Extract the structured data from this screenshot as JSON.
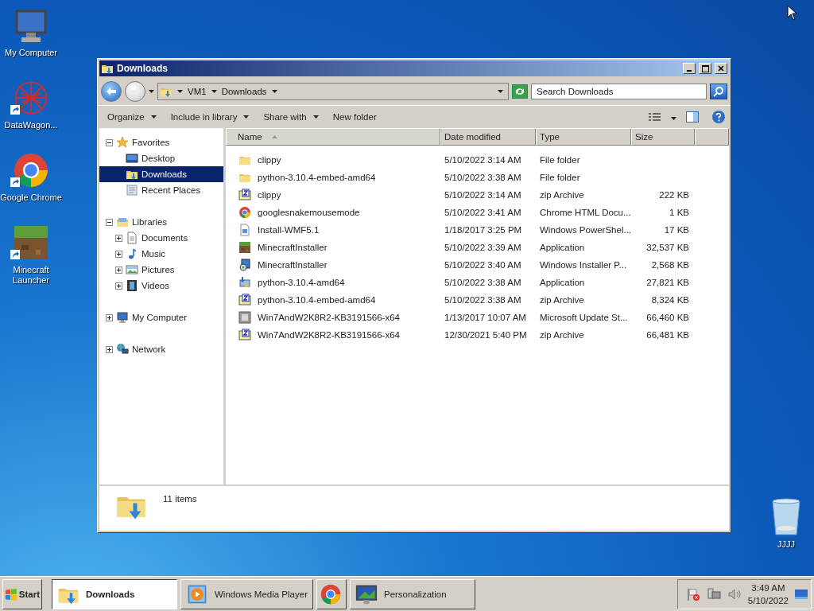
{
  "desktop_icons": [
    {
      "label": "My Computer",
      "kind": "computer",
      "shortcut": false
    },
    {
      "label": "DataWagon...",
      "kind": "datawagon",
      "shortcut": true
    },
    {
      "label": "Google Chrome",
      "kind": "chrome",
      "shortcut": true
    },
    {
      "label": "Minecraft Launcher",
      "kind": "minecraft",
      "shortcut": true
    }
  ],
  "recycle_bin": {
    "label": "JJJJ"
  },
  "window": {
    "title": "Downloads",
    "address": {
      "segments": [
        "VM1",
        "Downloads"
      ]
    },
    "search": {
      "placeholder": "Search Downloads"
    },
    "toolbar": [
      {
        "label": "Organize",
        "menu": true
      },
      {
        "label": "Include in library",
        "menu": true
      },
      {
        "label": "Share with",
        "menu": true
      },
      {
        "label": "New folder",
        "menu": false
      }
    ],
    "nav": [
      {
        "label": "Favorites",
        "kind": "star",
        "expanded": true,
        "children": [
          {
            "label": "Desktop",
            "kind": "desktop",
            "selected": false
          },
          {
            "label": "Downloads",
            "kind": "downloads",
            "selected": true
          },
          {
            "label": "Recent Places",
            "kind": "recent",
            "selected": false
          }
        ]
      },
      {
        "label": "Libraries",
        "kind": "library",
        "expanded": true,
        "children": [
          {
            "label": "Documents",
            "kind": "documents",
            "expanded": false,
            "selected": false
          },
          {
            "label": "Music",
            "kind": "music",
            "expanded": false,
            "selected": false
          },
          {
            "label": "Pictures",
            "kind": "pictures",
            "expanded": false,
            "selected": false
          },
          {
            "label": "Videos",
            "kind": "videos",
            "expanded": false,
            "selected": false
          }
        ]
      },
      {
        "label": "My Computer",
        "kind": "computer",
        "expanded": false
      },
      {
        "label": "Network",
        "kind": "network",
        "expanded": false
      }
    ],
    "columns": [
      {
        "label": "Name",
        "sorted": true
      },
      {
        "label": "Date modified",
        "sorted": false
      },
      {
        "label": "Type",
        "sorted": false
      },
      {
        "label": "Size",
        "sorted": false
      }
    ],
    "rows": [
      {
        "kind": "folder",
        "name": "clippy",
        "date": "5/10/2022 3:14 AM",
        "type": "File folder"
      },
      {
        "kind": "folder",
        "name": "python-3.10.4-embed-amd64",
        "date": "5/10/2022 3:38 AM",
        "type": "File folder"
      },
      {
        "kind": "zip",
        "name": "clippy",
        "date": "5/10/2022 3:14 AM",
        "type": "zip Archive",
        "size": "222 KB"
      },
      {
        "kind": "chrome",
        "name": "googlesnakemousemode",
        "date": "5/10/2022 3:41 AM",
        "type": "Chrome HTML Docu...",
        "size": "1 KB"
      },
      {
        "kind": "script",
        "name": "Install-WMF5.1",
        "date": "1/18/2017 3:25 PM",
        "type": "Windows PowerShel...",
        "size": "17 KB"
      },
      {
        "kind": "minecraft",
        "name": "MinecraftInstaller",
        "date": "5/10/2022 3:39 AM",
        "type": "Application",
        "size": "32,537 KB"
      },
      {
        "kind": "installer",
        "name": "MinecraftInstaller",
        "date": "5/10/2022 3:40 AM",
        "type": "Windows Installer P...",
        "size": "2,568 KB"
      },
      {
        "kind": "setup",
        "name": "python-3.10.4-amd64",
        "date": "5/10/2022 3:38 AM",
        "type": "Application",
        "size": "27,821 KB"
      },
      {
        "kind": "zip",
        "name": "python-3.10.4-embed-amd64",
        "date": "5/10/2022 3:38 AM",
        "type": "zip Archive",
        "size": "8,324 KB"
      },
      {
        "kind": "update",
        "name": "Win7AndW2K8R2-KB3191566-x64",
        "date": "1/13/2017 10:07 AM",
        "type": "Microsoft Update St...",
        "size": "66,460 KB"
      },
      {
        "kind": "zip",
        "name": "Win7AndW2K8R2-KB3191566-x64",
        "date": "12/30/2021 5:40 PM",
        "type": "zip Archive",
        "size": "66,481 KB"
      }
    ],
    "status": "11 items"
  },
  "taskbar": {
    "start": "Start",
    "buttons": [
      {
        "label": "Downloads",
        "kind": "explorer",
        "selected": true
      },
      {
        "label": "Windows Media Player",
        "kind": "media",
        "selected": false
      },
      {
        "kind": "chrome",
        "selected": false
      },
      {
        "label": "Personalization",
        "kind": "personalization",
        "selected": false
      }
    ],
    "clock": {
      "time": "3:49 AM",
      "date": "5/10/2022"
    }
  }
}
